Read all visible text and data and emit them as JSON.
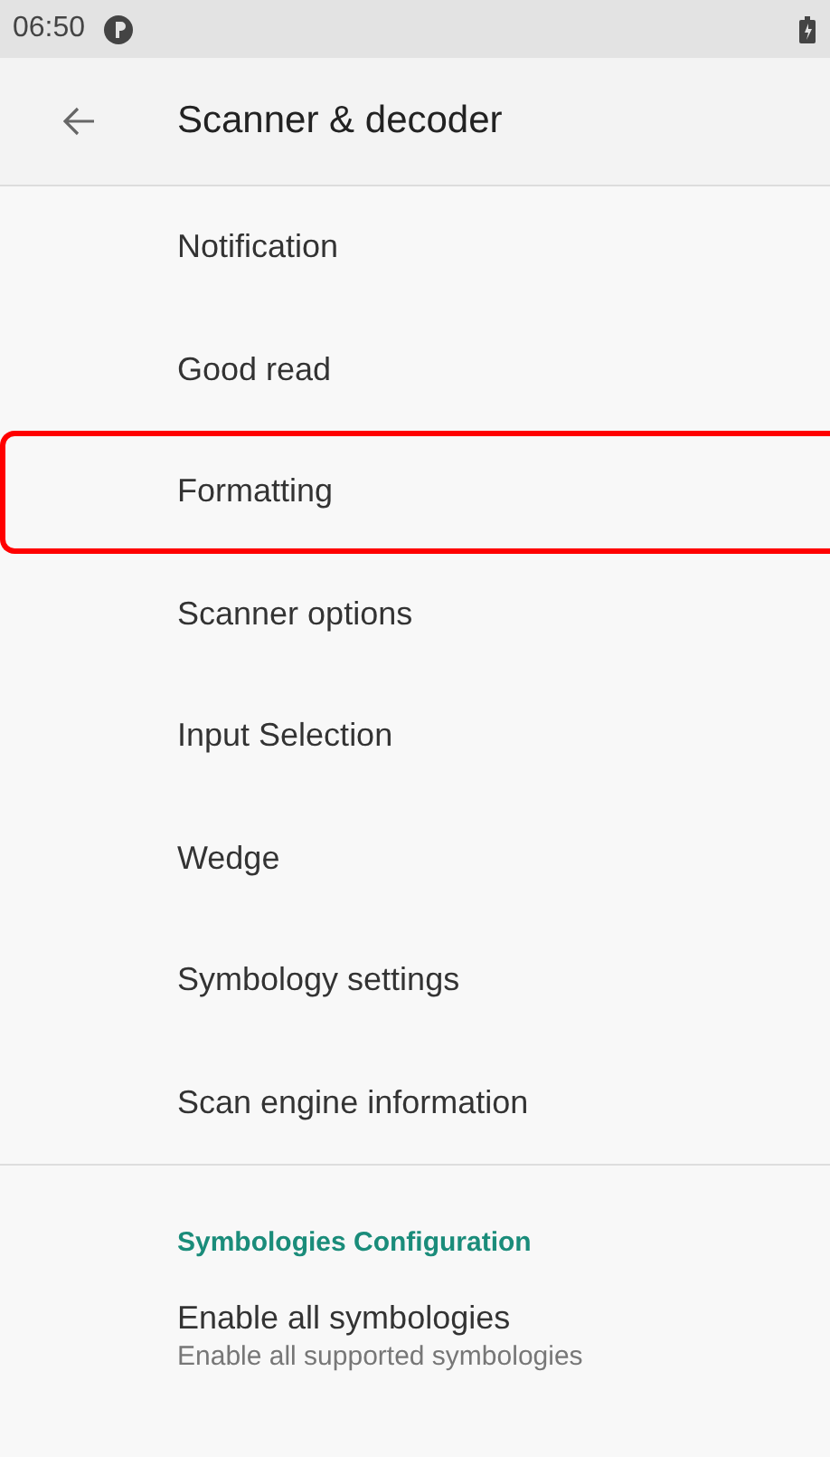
{
  "status_bar": {
    "time": "06:50"
  },
  "app_bar": {
    "title": "Scanner & decoder"
  },
  "items": [
    {
      "title": "Notification",
      "highlighted": false
    },
    {
      "title": "Good read",
      "highlighted": false
    },
    {
      "title": "Formatting",
      "highlighted": true
    },
    {
      "title": "Scanner options",
      "highlighted": false
    },
    {
      "title": "Input Selection",
      "highlighted": false
    },
    {
      "title": "Wedge",
      "highlighted": false
    },
    {
      "title": "Symbology settings",
      "highlighted": false
    },
    {
      "title": "Scan engine information",
      "highlighted": false
    }
  ],
  "category": {
    "title": "Symbologies Configuration",
    "items": [
      {
        "title": "Enable all symbologies",
        "summary": "Enable all supported symbologies"
      }
    ]
  }
}
